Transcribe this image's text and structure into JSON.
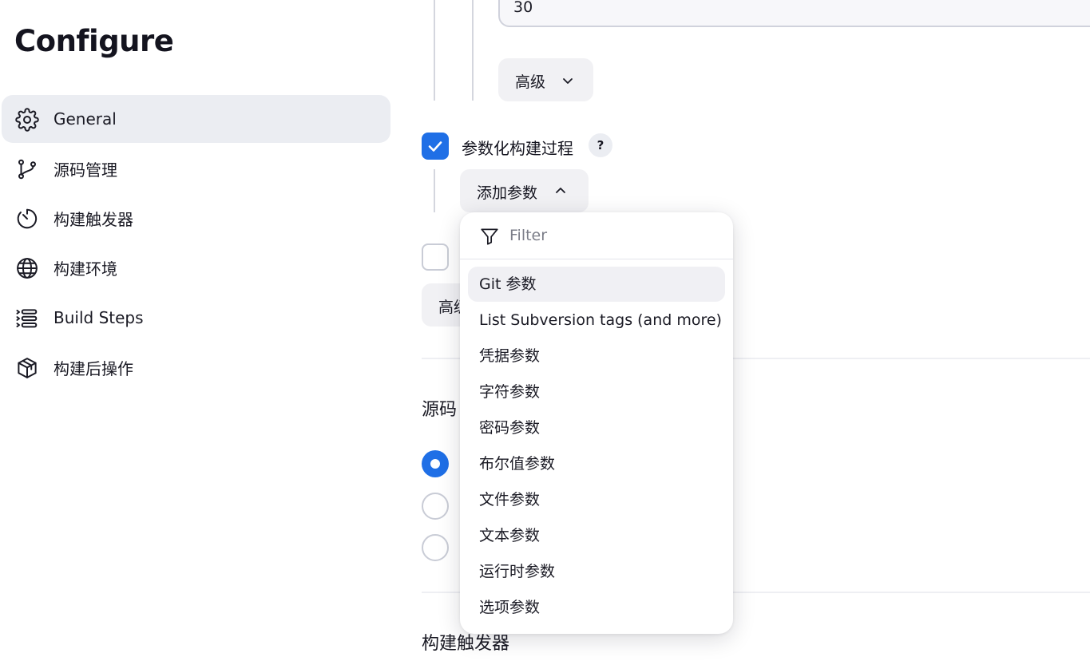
{
  "page": {
    "title": "Configure"
  },
  "sidebar": {
    "items": [
      {
        "label": "General",
        "icon": "gear-icon",
        "active": true
      },
      {
        "label": "源码管理",
        "icon": "git-branch-icon"
      },
      {
        "label": "构建触发器",
        "icon": "timer-icon"
      },
      {
        "label": "构建环境",
        "icon": "globe-icon"
      },
      {
        "label": "Build Steps",
        "icon": "list-icon"
      },
      {
        "label": "构建后操作",
        "icon": "package-icon"
      }
    ]
  },
  "main": {
    "top_input_value": "30",
    "advanced_label": "高级",
    "advanced_label_partial": "高级",
    "parameterized": {
      "label": "参数化构建过程",
      "checked": true,
      "help": "?"
    },
    "add_param_label": "添加参数",
    "section_scm_partial": "源码",
    "section_triggers": "构建触发器"
  },
  "dropdown": {
    "filter_placeholder": "Filter",
    "items": [
      "Git 参数",
      "List Subversion tags (and more)",
      "凭据参数",
      "字符参数",
      "密码参数",
      "布尔值参数",
      "文件参数",
      "文本参数",
      "运行时参数",
      "选项参数"
    ],
    "highlighted_index": 0
  },
  "colors": {
    "accent": "#1f6fe6",
    "active_bg": "#ebedf2"
  }
}
